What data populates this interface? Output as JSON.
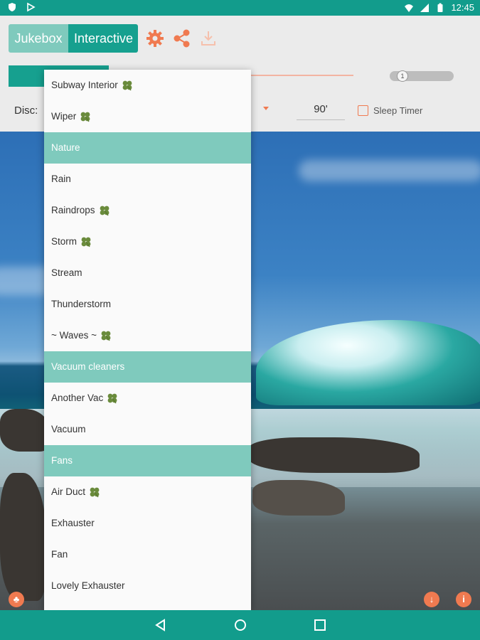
{
  "status_bar": {
    "time": "12:45",
    "icons": [
      "shield-icon",
      "play-store-icon",
      "wifi-icon",
      "signal-icon",
      "battery-icon"
    ]
  },
  "toolbar": {
    "tabs": [
      {
        "label": "Jukebox",
        "selected": false
      },
      {
        "label": "Interactive",
        "selected": true
      }
    ],
    "icons": [
      "gear-icon",
      "share-icon",
      "download-tray-icon"
    ],
    "volume_value": "1",
    "disc_label": "Disc:",
    "minutes_value": "90'",
    "sleep_timer_label": "Sleep Timer",
    "sleep_timer_checked": false
  },
  "dropdown": {
    "items": [
      {
        "label": "Subway Interior",
        "type": "item",
        "clover": true
      },
      {
        "label": "Wiper",
        "type": "item",
        "clover": true
      },
      {
        "label": "Nature",
        "type": "header",
        "clover": false
      },
      {
        "label": "Rain",
        "type": "item",
        "clover": false
      },
      {
        "label": "Raindrops",
        "type": "item",
        "clover": true
      },
      {
        "label": "Storm",
        "type": "item",
        "clover": true
      },
      {
        "label": "Stream",
        "type": "item",
        "clover": false
      },
      {
        "label": "Thunderstorm",
        "type": "item",
        "clover": false
      },
      {
        "label": "~ Waves ~",
        "type": "item",
        "clover": true
      },
      {
        "label": "Vacuum cleaners",
        "type": "header",
        "clover": false
      },
      {
        "label": "Another Vac",
        "type": "item",
        "clover": true
      },
      {
        "label": "Vacuum",
        "type": "item",
        "clover": false
      },
      {
        "label": "Fans",
        "type": "header",
        "clover": false
      },
      {
        "label": "Air Duct",
        "type": "item",
        "clover": true
      },
      {
        "label": "Exhauster",
        "type": "item",
        "clover": false
      },
      {
        "label": "Fan",
        "type": "item",
        "clover": false
      },
      {
        "label": "Lovely Exhauster",
        "type": "item",
        "clover": false
      }
    ]
  },
  "corner_buttons": {
    "left": "clover-icon",
    "right": [
      "download-icon",
      "info-icon"
    ]
  },
  "nav_bar": {
    "buttons": [
      "back-icon",
      "home-icon",
      "recents-icon"
    ]
  },
  "colors": {
    "teal": "#129c8c",
    "teal_light": "#7fcabd",
    "accent": "#f07a50"
  }
}
